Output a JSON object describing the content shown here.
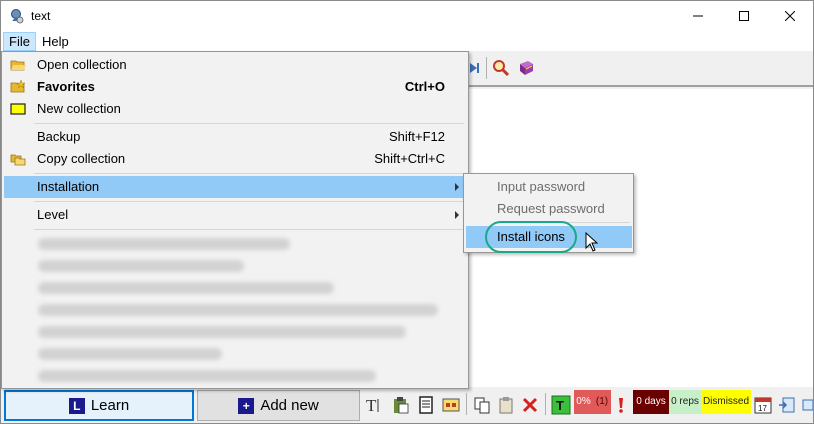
{
  "window": {
    "title": "text"
  },
  "menubar": {
    "file": "File",
    "help": "Help"
  },
  "file_menu": {
    "open_collection": "Open collection",
    "favorites": "Favorites",
    "favorites_shortcut": "Ctrl+O",
    "new_collection": "New collection",
    "backup": "Backup",
    "backup_shortcut": "Shift+F12",
    "copy_collection": "Copy collection",
    "copy_collection_shortcut": "Shift+Ctrl+C",
    "installation": "Installation",
    "level": "Level"
  },
  "installation_submenu": {
    "input_password": "Input password",
    "request_password": "Request password",
    "install_icons": "Install icons"
  },
  "bottom": {
    "learn": "Learn",
    "add_new": "Add new",
    "percent": "0%",
    "count": "(1)",
    "days": "0 days",
    "reps": "0 reps",
    "dismissed": "Dismissed"
  },
  "colors": {
    "highlight": "#91c9f7",
    "callout": "#1aa88a",
    "percent_bg": "#e05a5a",
    "days_bg": "#6b0000",
    "reps_bg": "#c8f0c8",
    "dismissed_bg": "#ffff00"
  }
}
